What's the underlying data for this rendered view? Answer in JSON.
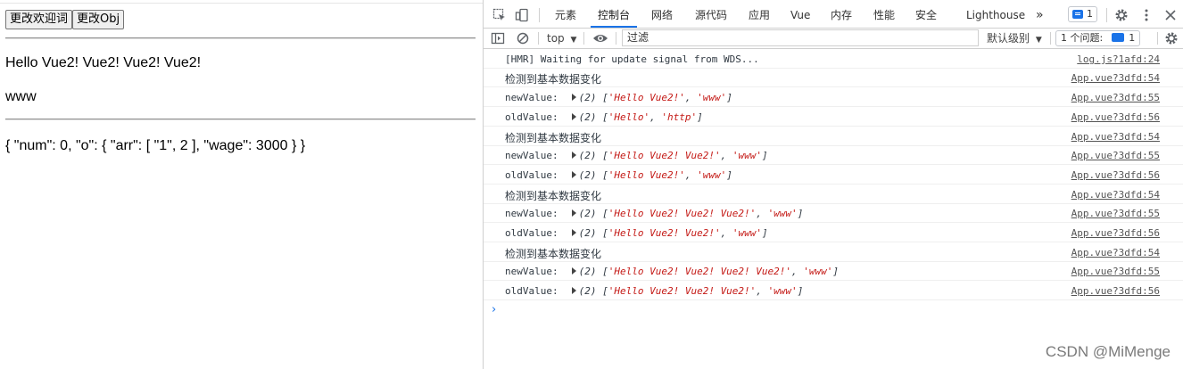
{
  "page": {
    "buttons": [
      "更改欢迎词",
      "更改Obj"
    ],
    "greeting": "Hello Vue2! Vue2! Vue2! Vue2!",
    "url_text": "www",
    "obj_json": "{ \"num\": 0, \"o\": { \"arr\": [ \"1\", 2 ], \"wage\": 3000 } }"
  },
  "devtools": {
    "tabs": [
      "元素",
      "控制台",
      "网络",
      "源代码",
      "应用",
      "Vue",
      "内存",
      "性能",
      "安全",
      "Lighthouse"
    ],
    "active_tab": "控制台",
    "more_tabs": "»",
    "issues_badge_count": "1",
    "toolbar": {
      "context": "top",
      "filter_placeholder": "过滤",
      "level": "默认级别",
      "issues_label": "1 个问题:",
      "issues_count": "1"
    },
    "accent_color": "#1a73e8",
    "string_color": "#c41a16",
    "console": [
      {
        "text": "[HMR] Waiting for update signal from WDS...",
        "source": "log.js?1afd:24"
      },
      {
        "text": "检测到基本数据变化",
        "source": "App.vue?3dfd:54"
      },
      {
        "key": "newValue:",
        "count": "(2)",
        "a": "'Hello Vue2!'",
        "b": "'www'",
        "source": "App.vue?3dfd:55"
      },
      {
        "key": "oldValue:",
        "count": "(2)",
        "a": "'Hello'",
        "b": "'http'",
        "source": "App.vue?3dfd:56"
      },
      {
        "text": "检测到基本数据变化",
        "source": "App.vue?3dfd:54"
      },
      {
        "key": "newValue:",
        "count": "(2)",
        "a": "'Hello Vue2! Vue2!'",
        "b": "'www'",
        "source": "App.vue?3dfd:55"
      },
      {
        "key": "oldValue:",
        "count": "(2)",
        "a": "'Hello Vue2!'",
        "b": "'www'",
        "source": "App.vue?3dfd:56"
      },
      {
        "text": "检测到基本数据变化",
        "source": "App.vue?3dfd:54"
      },
      {
        "key": "newValue:",
        "count": "(2)",
        "a": "'Hello Vue2! Vue2! Vue2!'",
        "b": "'www'",
        "source": "App.vue?3dfd:55"
      },
      {
        "key": "oldValue:",
        "count": "(2)",
        "a": "'Hello Vue2! Vue2!'",
        "b": "'www'",
        "source": "App.vue?3dfd:56"
      },
      {
        "text": "检测到基本数据变化",
        "source": "App.vue?3dfd:54"
      },
      {
        "key": "newValue:",
        "count": "(2)",
        "a": "'Hello Vue2! Vue2! Vue2! Vue2!'",
        "b": "'www'",
        "source": "App.vue?3dfd:55"
      },
      {
        "key": "oldValue:",
        "count": "(2)",
        "a": "'Hello Vue2! Vue2! Vue2!'",
        "b": "'www'",
        "source": "App.vue?3dfd:56"
      }
    ],
    "prompt_symbol": "›"
  },
  "watermark": "CSDN @MiMenge"
}
